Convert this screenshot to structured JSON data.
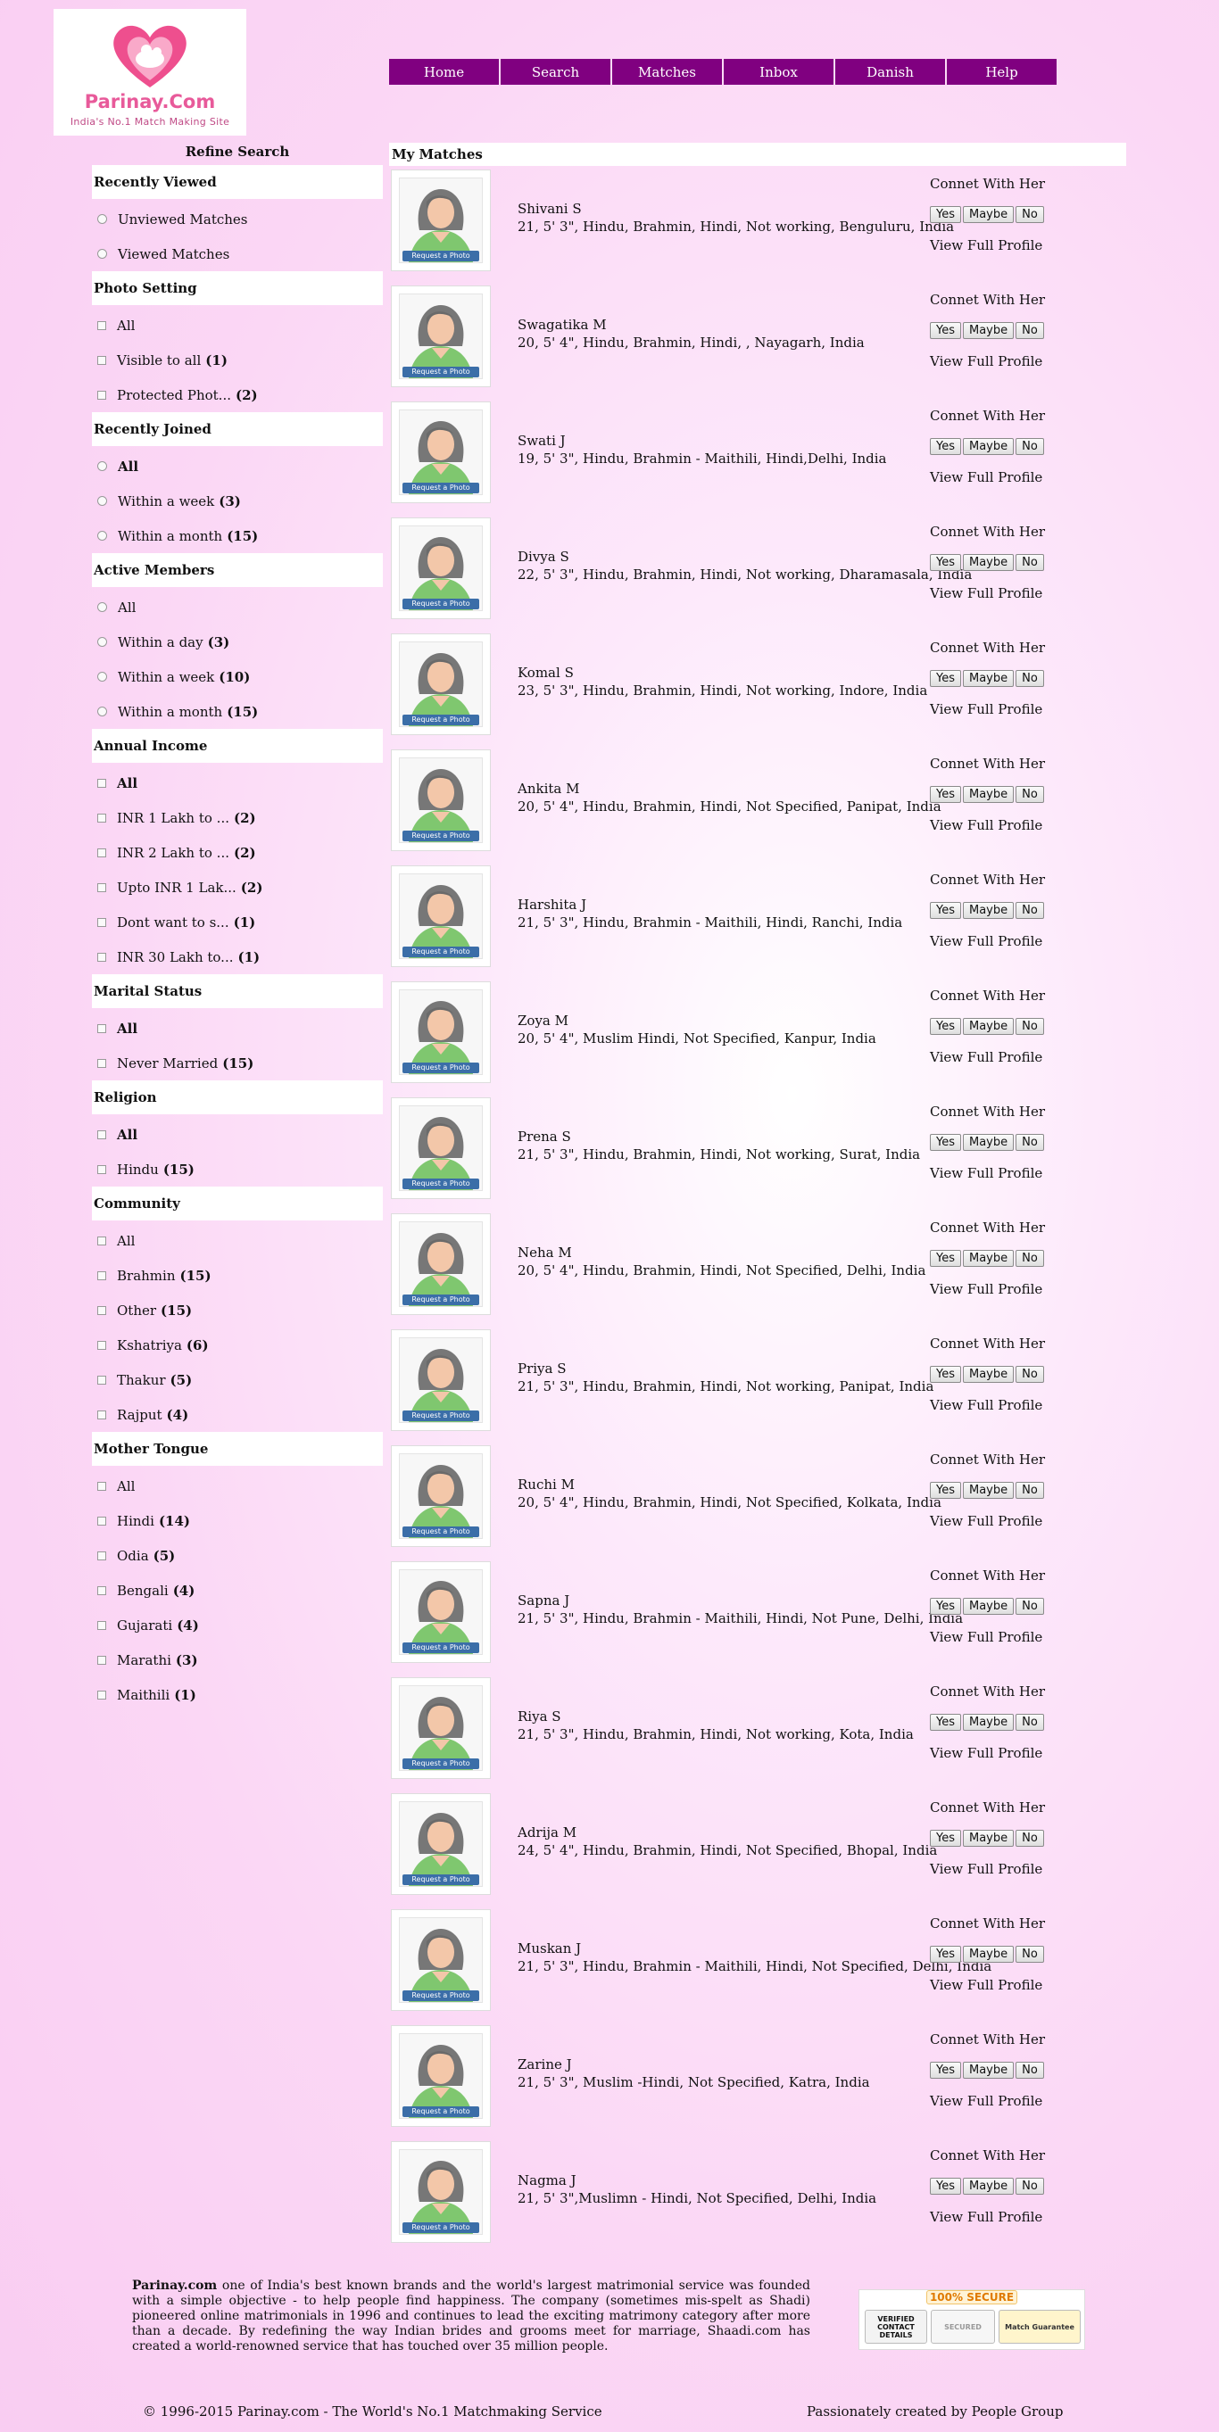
{
  "brand": {
    "name": "Parinay.Com",
    "tagline": "India's No.1 Match Making Site"
  },
  "nav": [
    {
      "label": "Home"
    },
    {
      "label": "Search"
    },
    {
      "label": "Matches"
    },
    {
      "label": "Inbox"
    },
    {
      "label": "Danish"
    },
    {
      "label": "Help"
    }
  ],
  "sidebar": {
    "title": "Refine Search",
    "sections": [
      {
        "title": "Recently Viewed",
        "control": "radio",
        "options": [
          {
            "label": "Unviewed Matches",
            "count": ""
          },
          {
            "label": "Viewed Matches",
            "count": ""
          }
        ]
      },
      {
        "title": "Photo Setting",
        "control": "checkbox",
        "options": [
          {
            "label": "All",
            "count": ""
          },
          {
            "label": "Visible to all",
            "count": "(1)"
          },
          {
            "label": "Protected Phot...",
            "count": "(2)"
          }
        ]
      },
      {
        "title": "Recently Joined",
        "control": "radio",
        "options": [
          {
            "label": "All",
            "count": "",
            "bold": true
          },
          {
            "label": "Within a week",
            "count": "(3)"
          },
          {
            "label": "Within a month",
            "count": "(15)"
          }
        ]
      },
      {
        "title": "Active Members",
        "control": "radio",
        "options": [
          {
            "label": "All",
            "count": ""
          },
          {
            "label": "Within a day",
            "count": "(3)"
          },
          {
            "label": "Within a week",
            "count": "(10)"
          },
          {
            "label": "Within a month",
            "count": "(15)"
          }
        ]
      },
      {
        "title": "Annual Income",
        "control": "checkbox",
        "options": [
          {
            "label": "All",
            "count": "",
            "bold": true
          },
          {
            "label": "INR 1 Lakh to ...",
            "count": "(2)"
          },
          {
            "label": "INR 2 Lakh to ...",
            "count": "(2)"
          },
          {
            "label": "Upto INR 1 Lak...",
            "count": "(2)"
          },
          {
            "label": "Dont want to s...",
            "count": "(1)"
          },
          {
            "label": "INR 30 Lakh to...",
            "count": "(1)"
          }
        ]
      },
      {
        "title": "Marital Status",
        "control": "checkbox",
        "options": [
          {
            "label": "All",
            "count": "",
            "bold": true
          },
          {
            "label": "Never Married",
            "count": "(15)"
          }
        ]
      },
      {
        "title": "Religion",
        "control": "checkbox",
        "options": [
          {
            "label": "All",
            "count": "",
            "bold": true
          },
          {
            "label": "Hindu",
            "count": "(15)"
          }
        ]
      },
      {
        "title": "Community",
        "control": "checkbox",
        "options": [
          {
            "label": "All",
            "count": ""
          },
          {
            "label": "Brahmin",
            "count": "(15)"
          },
          {
            "label": "Other",
            "count": "(15)"
          },
          {
            "label": "Kshatriya",
            "count": "(6)"
          },
          {
            "label": "Thakur",
            "count": "(5)"
          },
          {
            "label": "Rajput",
            "count": "(4)"
          }
        ]
      },
      {
        "title": "Mother Tongue",
        "control": "checkbox",
        "options": [
          {
            "label": "All",
            "count": ""
          },
          {
            "label": "Hindi",
            "count": "(14)"
          },
          {
            "label": "Odia",
            "count": "(5)"
          },
          {
            "label": "Bengali",
            "count": "(4)"
          },
          {
            "label": "Gujarati",
            "count": "(4)"
          },
          {
            "label": "Marathi",
            "count": "(3)"
          },
          {
            "label": "Maithili",
            "count": "(1)"
          }
        ]
      }
    ]
  },
  "matches": {
    "title": "My Matches",
    "photo_button": "Request a Photo",
    "connect_label": "Connet With Her",
    "yes_label": "Yes",
    "maybe_label": "Maybe",
    "no_label": "No",
    "view_label": "View Full Profile",
    "items": [
      {
        "name": "Shivani S",
        "details": "21, 5' 3\", Hindu, Brahmin, Hindi, Not working, Benguluru, India"
      },
      {
        "name": "Swagatika M",
        "details": "20, 5' 4\", Hindu, Brahmin, Hindi, , Nayagarh, India"
      },
      {
        "name": "Swati J",
        "details": "19, 5' 3\", Hindu, Brahmin - Maithili, Hindi,Delhi, India"
      },
      {
        "name": "Divya S",
        "details": "22, 5' 3\", Hindu, Brahmin, Hindi, Not working, Dharamasala, India"
      },
      {
        "name": "Komal S",
        "details": "23, 5' 3\", Hindu, Brahmin, Hindi, Not working, Indore, India"
      },
      {
        "name": "Ankita M",
        "details": "20, 5' 4\", Hindu, Brahmin, Hindi, Not Specified, Panipat, India"
      },
      {
        "name": "Harshita J",
        "details": "21, 5' 3\", Hindu, Brahmin - Maithili, Hindi, Ranchi, India"
      },
      {
        "name": "Zoya M",
        "details": "20, 5' 4\", Muslim Hindi, Not Specified, Kanpur, India"
      },
      {
        "name": "Prena S",
        "details": "21, 5' 3\", Hindu, Brahmin, Hindi, Not working, Surat, India"
      },
      {
        "name": "Neha M",
        "details": "20, 5' 4\", Hindu, Brahmin, Hindi, Not Specified, Delhi, India"
      },
      {
        "name": "Priya S",
        "details": "21, 5' 3\", Hindu, Brahmin, Hindi, Not working, Panipat, India"
      },
      {
        "name": "Ruchi M",
        "details": "20, 5' 4\", Hindu, Brahmin, Hindi, Not Specified, Kolkata, India"
      },
      {
        "name": "Sapna J",
        "details": "21, 5' 3\", Hindu, Brahmin - Maithili, Hindi, Not Pune, Delhi, India"
      },
      {
        "name": "Riya S",
        "details": "21, 5' 3\", Hindu, Brahmin, Hindi, Not working, Kota, India"
      },
      {
        "name": "Adrija M",
        "details": "24, 5' 4\", Hindu, Brahmin, Hindi, Not Specified, Bhopal, India"
      },
      {
        "name": "Muskan J",
        "details": "21, 5' 3\", Hindu, Brahmin - Maithili, Hindi, Not Specified, Delhi, India"
      },
      {
        "name": "Zarine J",
        "details": "21, 5' 3\", Muslim -Hindi, Not Specified, Katra, India"
      },
      {
        "name": "Nagma J",
        "details": "21, 5' 3\",Muslimn - Hindi, Not Specified, Delhi, India"
      }
    ]
  },
  "about": {
    "brand": "Parinay.com",
    "text": " one of India's best known brands and the world's largest matrimonial service was founded with a simple objective - to help people find happiness. The company (sometimes mis-spelt as Shadi) pioneered online matrimonials in 1996 and continues to lead the exciting matrimony category after more than a decade. By redefining the way Indian brides and grooms meet for marriage, Shaadi.com has created a world-renowned service that has touched over 35 million people."
  },
  "secure_badge": {
    "title": "100% SECURE",
    "verified": "VERIFIED CONTACT DETAILS",
    "secured": "SECURED",
    "guarantee": "Match Guarantee"
  },
  "footer": {
    "copyright": "© 1996-2015 Parinay.com - The World's No.1 Matchmaking Service",
    "credit": "Passionately created by People Group"
  },
  "colors": {
    "nav_bg": "#800080",
    "page_bg": "#f9cdf2",
    "logo_pink": "#e85a9a",
    "request_btn": "#3b6ea8"
  }
}
